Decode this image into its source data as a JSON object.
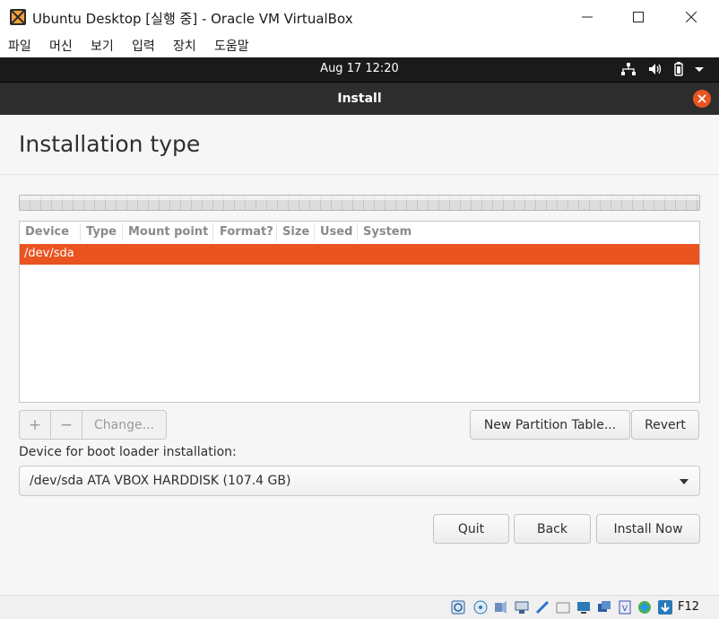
{
  "window": {
    "title": "Ubuntu Desktop [실행 중] - Oracle VM VirtualBox",
    "menu": [
      "파일",
      "머신",
      "보기",
      "입력",
      "장치",
      "도움말"
    ]
  },
  "topbar": {
    "clock": "Aug 17  12:20"
  },
  "installer": {
    "header_title": "Install",
    "page_title": "Installation type",
    "columns": [
      "Device",
      "Type",
      "Mount point",
      "Format?",
      "Size",
      "Used",
      "System"
    ],
    "rows": [
      {
        "device": "/dev/sda"
      }
    ],
    "add_label": "+",
    "remove_label": "−",
    "change_label": "Change...",
    "new_table_label": "New Partition Table...",
    "revert_label": "Revert",
    "boot_label": "Device for boot loader installation:",
    "boot_value": "/dev/sda ATA VBOX HARDDISK (107.4 GB)",
    "quit_label": "Quit",
    "back_label": "Back",
    "install_label": "Install Now"
  },
  "statusbar": {
    "host_key": "F12"
  },
  "colors": {
    "accent": "#e95420",
    "topbar": "#1a1a1a",
    "header": "#2d2d2d"
  }
}
